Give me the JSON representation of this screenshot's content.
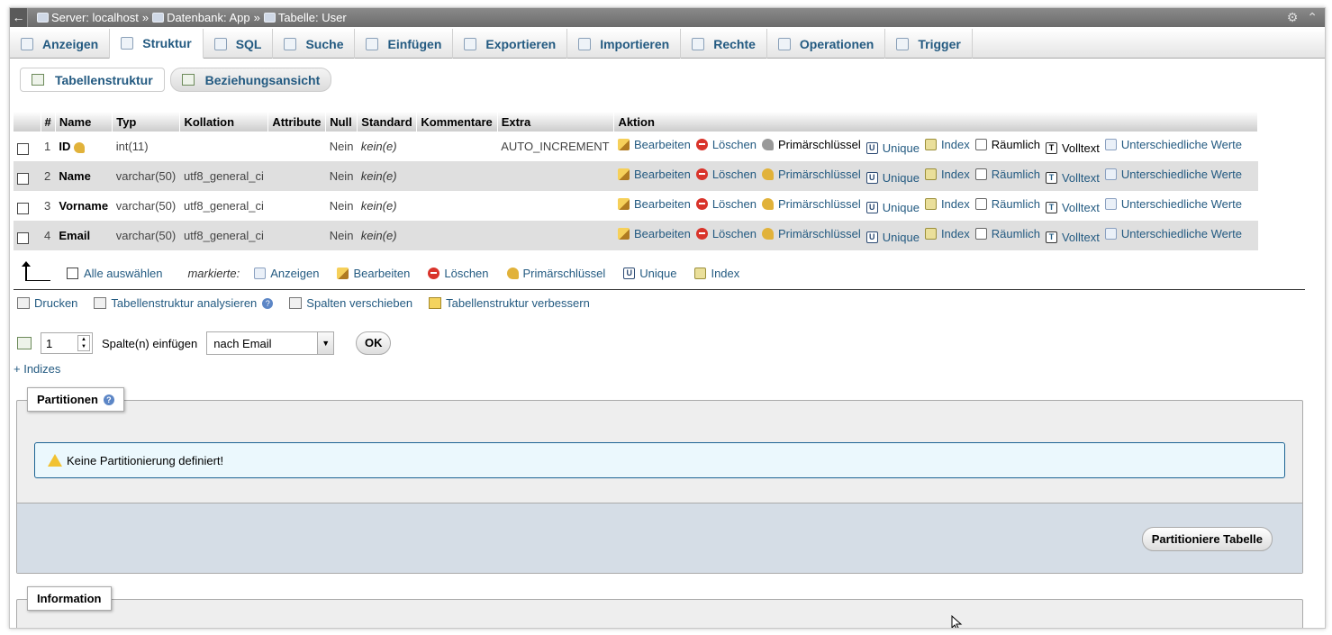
{
  "breadcrumb": {
    "back": "←",
    "server": "Server: localhost",
    "database": "Datenbank: App",
    "table": "Tabelle: User",
    "sep": "»"
  },
  "tabs": [
    {
      "label": "Anzeigen",
      "icon": "browse-icon"
    },
    {
      "label": "Struktur",
      "icon": "structure-icon",
      "active": true
    },
    {
      "label": "SQL",
      "icon": "sql-icon"
    },
    {
      "label": "Suche",
      "icon": "search-icon"
    },
    {
      "label": "Einfügen",
      "icon": "insert-icon"
    },
    {
      "label": "Exportieren",
      "icon": "export-icon"
    },
    {
      "label": "Importieren",
      "icon": "import-icon"
    },
    {
      "label": "Rechte",
      "icon": "privileges-icon"
    },
    {
      "label": "Operationen",
      "icon": "wrench-icon"
    },
    {
      "label": "Trigger",
      "icon": "trigger-icon"
    }
  ],
  "subtabs": {
    "structure": "Tabellenstruktur",
    "relation": "Beziehungsansicht"
  },
  "table": {
    "headers": {
      "num": "#",
      "name": "Name",
      "type": "Typ",
      "collation": "Kollation",
      "attributes": "Attribute",
      "null": "Null",
      "default": "Standard",
      "comments": "Kommentare",
      "extra": "Extra",
      "action": "Aktion"
    },
    "rows": [
      {
        "num": "1",
        "name": "ID",
        "type": "int(11)",
        "collation": "",
        "null": "Nein",
        "default": "kein(e)",
        "extra": "AUTO_INCREMENT"
      },
      {
        "num": "2",
        "name": "Name",
        "type": "varchar(50)",
        "collation": "utf8_general_ci",
        "null": "Nein",
        "default": "kein(e)",
        "extra": ""
      },
      {
        "num": "3",
        "name": "Vorname",
        "type": "varchar(50)",
        "collation": "utf8_general_ci",
        "null": "Nein",
        "default": "kein(e)",
        "extra": ""
      },
      {
        "num": "4",
        "name": "Email",
        "type": "varchar(50)",
        "collation": "utf8_general_ci",
        "null": "Nein",
        "default": "kein(e)",
        "extra": ""
      }
    ],
    "actions": {
      "edit": "Bearbeiten",
      "drop": "Löschen",
      "primary": "Primärschlüssel",
      "unique": "Unique",
      "index": "Index",
      "spatial": "Räumlich",
      "fulltext": "Volltext",
      "distinct": "Unterschiedliche Werte"
    }
  },
  "bulk": {
    "select_all": "Alle auswählen",
    "marked": "markierte:",
    "browse": "Anzeigen",
    "edit": "Bearbeiten",
    "drop": "Löschen",
    "primary": "Primärschlüssel",
    "unique": "Unique",
    "index": "Index"
  },
  "tools": {
    "print": "Drucken",
    "analyze": "Tabellenstruktur analysieren",
    "move": "Spalten verschieben",
    "improve": "Tabellenstruktur verbessern"
  },
  "add_column": {
    "count": "1",
    "label": "Spalte(n) einfügen",
    "position": "nach Email",
    "ok": "OK"
  },
  "indexes_link": "+ Indizes",
  "partitions": {
    "legend": "Partitionen",
    "notice": "Keine Partitionierung definiert!",
    "button": "Partitioniere Tabelle"
  },
  "information": {
    "legend": "Information"
  }
}
